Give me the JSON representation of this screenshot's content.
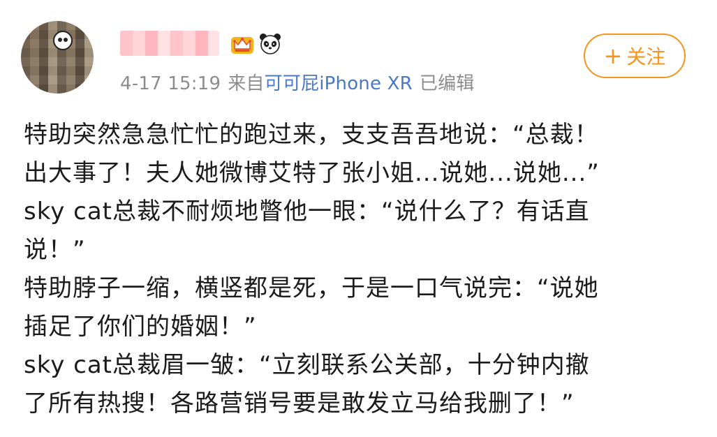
{
  "header": {
    "timestamp": "4-17 15:19",
    "source_prefix": "来自",
    "source_device": "可可屁iPhone XR",
    "edited_label": "已编辑"
  },
  "actions": {
    "follow_label": "关注",
    "follow_plus": "+"
  },
  "icons": {
    "crown": "crown-icon",
    "panda": "panda-icon",
    "follow_plus": "plus-icon"
  },
  "colors": {
    "accent": "#f7941d",
    "link": "#4a78c5",
    "meta": "#8c8c8c",
    "text": "#1b1b1b"
  },
  "post": {
    "lines": [
      "特助突然急急忙忙的跑过来，支支吾吾地说：“总裁！",
      "出大事了！夫人她微博艾特了张小姐...说她...说她...”",
      "sky cat总裁不耐烦地瞥他一眼：“说什么了？有话直",
      "说！”",
      "特助脖子一缩，横竖都是死，于是一口气说完：“说她",
      "插足了你们的婚姻！”",
      "sky cat总裁眉一皱：“立刻联系公关部，十分钟内撤",
      "了所有热搜！各路营销号要是敢发立马给我删了！”"
    ]
  }
}
